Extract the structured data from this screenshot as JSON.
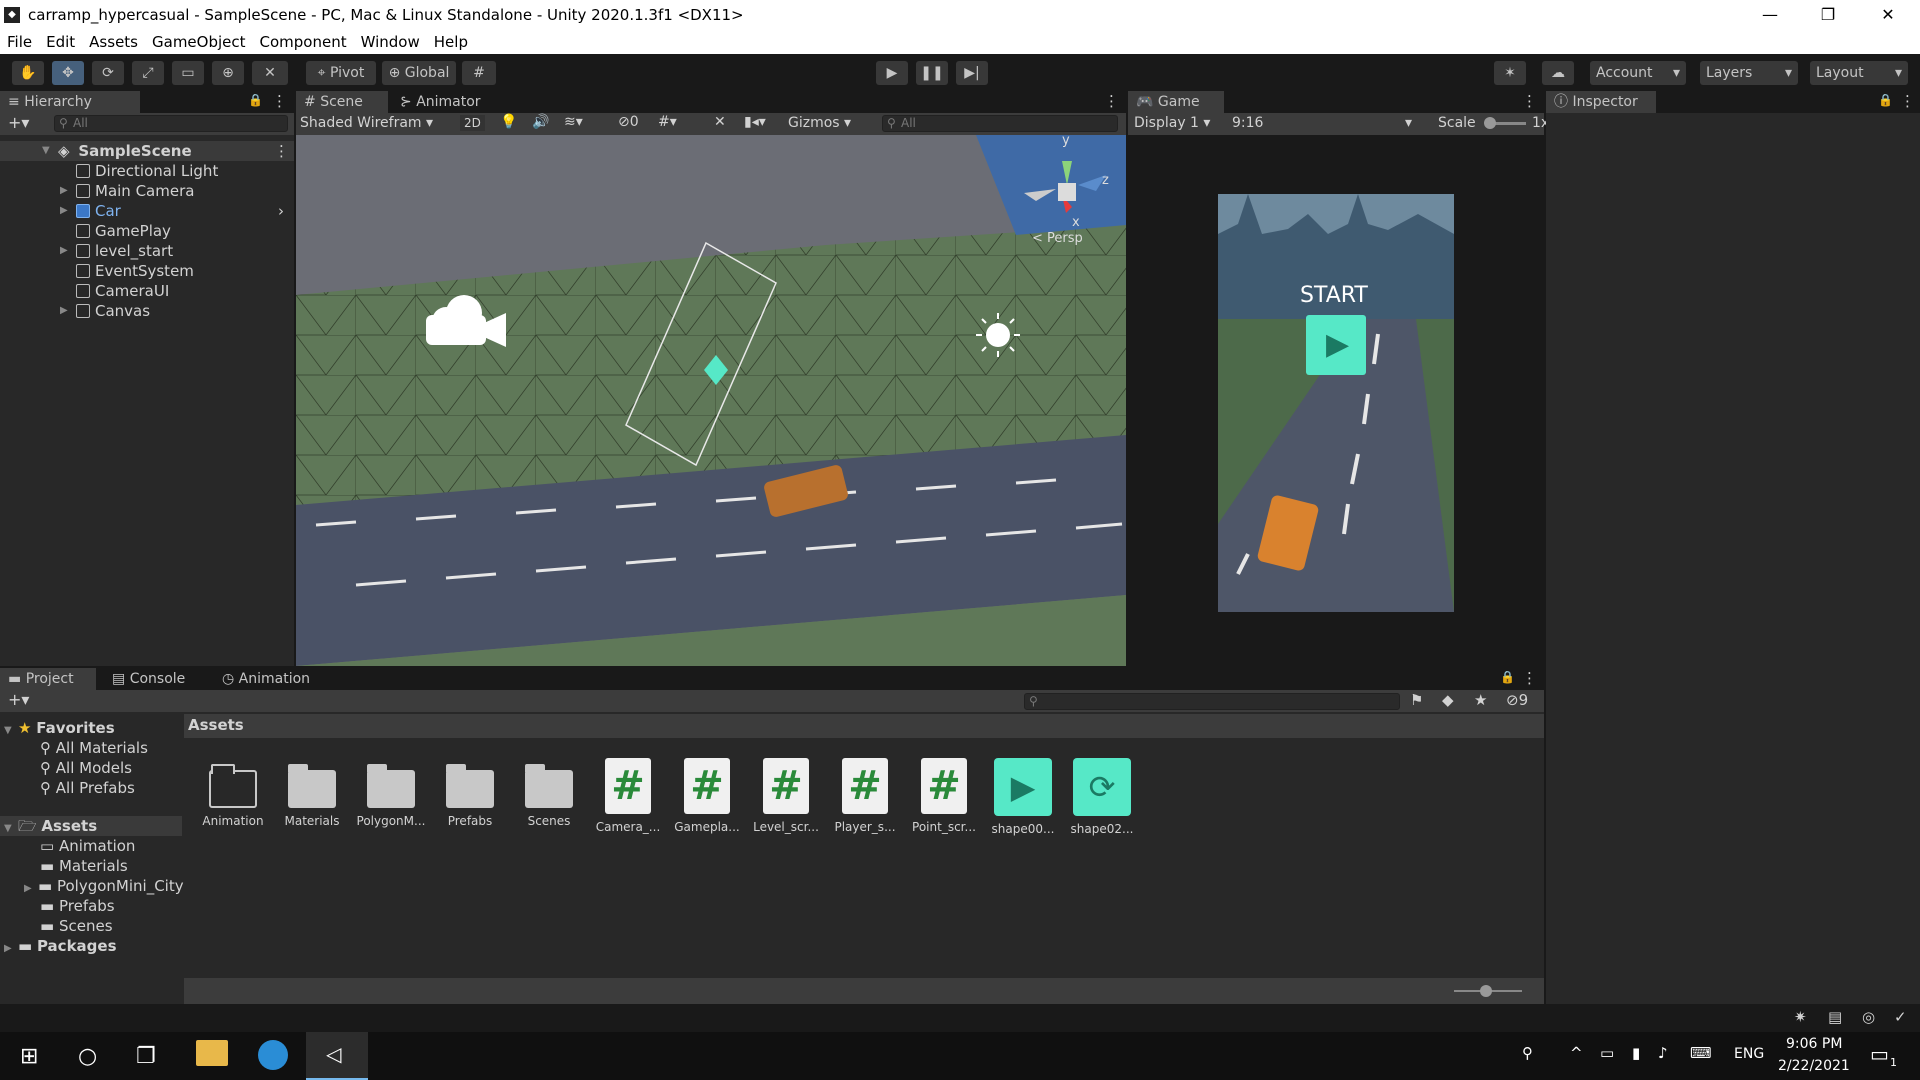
{
  "window": {
    "title": "carramp_hypercasual - SampleScene - PC, Mac & Linux Standalone - Unity 2020.1.3f1 <DX11>",
    "buttons": {
      "minimize": "—",
      "maximize": "❐",
      "close": "✕"
    }
  },
  "menu": [
    "File",
    "Edit",
    "Assets",
    "GameObject",
    "Component",
    "Window",
    "Help"
  ],
  "toolbar": {
    "pivot_label": "Pivot",
    "global_label": "Global",
    "account_label": "Account",
    "layers_label": "Layers",
    "layout_label": "Layout"
  },
  "hierarchy": {
    "tab_label": "Hierarchy",
    "search_placeholder": "All",
    "scene_name": "SampleScene",
    "items": [
      {
        "label": "Directional Light",
        "expandable": false,
        "selected": false
      },
      {
        "label": "Main Camera",
        "expandable": true,
        "selected": false
      },
      {
        "label": "Car",
        "expandable": true,
        "selected": true
      },
      {
        "label": "GamePlay",
        "expandable": false,
        "selected": false
      },
      {
        "label": "level_start",
        "expandable": true,
        "selected": false
      },
      {
        "label": "EventSystem",
        "expandable": false,
        "selected": false
      },
      {
        "label": "CameraUI",
        "expandable": false,
        "selected": false
      },
      {
        "label": "Canvas",
        "expandable": true,
        "selected": false
      }
    ]
  },
  "scene": {
    "tabs": [
      "Scene",
      "Animator"
    ],
    "shading_mode": "Shaded Wirefram",
    "mode_2d": "2D",
    "hidden_count": "0",
    "gizmos_label": "Gizmos",
    "search_placeholder": "All",
    "persp_label": "< Persp",
    "axis_y": "y",
    "axis_z": "z",
    "axis_x": "x"
  },
  "game": {
    "tab_label": "Game",
    "display": "Display 1",
    "aspect": "9:16",
    "scale_label": "Scale",
    "scale_value": "1x",
    "start_text": "START"
  },
  "inspector": {
    "tab_label": "Inspector"
  },
  "project": {
    "tabs": [
      "Project",
      "Console",
      "Animation"
    ],
    "hidden_count": "9",
    "favorites_label": "Favorites",
    "favorites": [
      "All Materials",
      "All Models",
      "All Prefabs"
    ],
    "assets_label": "Assets",
    "asset_folders": [
      "Animation",
      "Materials",
      "PolygonMini_City",
      "Prefabs",
      "Scenes"
    ],
    "packages_label": "Packages",
    "breadcrumb": "Assets",
    "assets": [
      {
        "name": "Animation",
        "kind": "folder-empty"
      },
      {
        "name": "Materials",
        "kind": "folder"
      },
      {
        "name": "PolygonM...",
        "kind": "folder"
      },
      {
        "name": "Prefabs",
        "kind": "folder"
      },
      {
        "name": "Scenes",
        "kind": "folder"
      },
      {
        "name": "Camera_...",
        "kind": "script"
      },
      {
        "name": "Gamepla...",
        "kind": "script"
      },
      {
        "name": "Level_scr...",
        "kind": "script"
      },
      {
        "name": "Player_s...",
        "kind": "script"
      },
      {
        "name": "Point_scr...",
        "kind": "script"
      },
      {
        "name": "shape00...",
        "kind": "shape-play"
      },
      {
        "name": "shape02...",
        "kind": "shape-cycle"
      }
    ]
  },
  "taskbar": {
    "language": "ENG",
    "time": "9:06 PM",
    "date": "2/22/2021",
    "notification_count": "1"
  },
  "colors": {
    "accent": "#46607c",
    "selection_text": "#7fb3f0",
    "mint": "#56e8c7"
  }
}
